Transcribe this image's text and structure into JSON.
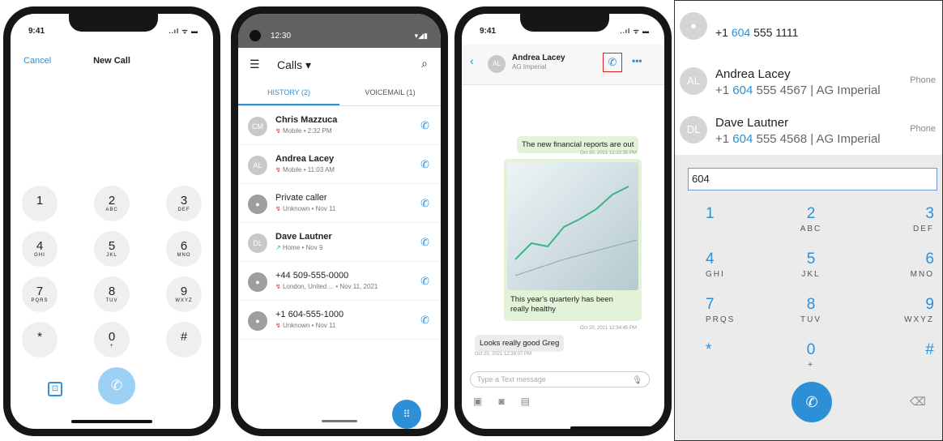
{
  "phone1": {
    "time": "9:41",
    "status_icons": "..ıl ᯤ ▬",
    "cancel": "Cancel",
    "title": "New Call",
    "keys": [
      {
        "d": "1",
        "l": ""
      },
      {
        "d": "2",
        "l": "ABC"
      },
      {
        "d": "3",
        "l": "DEF"
      },
      {
        "d": "4",
        "l": "GHI"
      },
      {
        "d": "5",
        "l": "JKL"
      },
      {
        "d": "6",
        "l": "MNO"
      },
      {
        "d": "7",
        "l": "PQRS"
      },
      {
        "d": "8",
        "l": "TUV"
      },
      {
        "d": "9",
        "l": "WXYZ"
      },
      {
        "d": "*",
        "l": ""
      },
      {
        "d": "0",
        "l": "+"
      },
      {
        "d": "#",
        "l": ""
      }
    ],
    "contacts_icon": "contacts-book-icon",
    "call_icon": "phone-icon"
  },
  "phone2": {
    "time": "12:30",
    "status_icons": "▾◢▮",
    "title": "Calls ▾",
    "tabs": [
      "HISTORY (2)",
      "VOICEMAIL (1)"
    ],
    "rows": [
      {
        "initials": "CM",
        "name": "Chris Mazzuca",
        "dir": "missed",
        "sub": "Mobile • 2:32 PM"
      },
      {
        "initials": "AL",
        "name": "Andrea Lacey",
        "dir": "missed",
        "sub": "Mobile • 11:03 AM"
      },
      {
        "initials": "",
        "name": "Private caller",
        "dir": "missed",
        "sub": "Unknown • Nov 11"
      },
      {
        "initials": "DL",
        "name": "Dave Lautner",
        "dir": "outgoing",
        "sub": "Home • Nov 9"
      },
      {
        "initials": "",
        "name": "+44 509-555-0000",
        "dir": "missed",
        "sub": "London, United ... • Nov 11, 2021"
      },
      {
        "initials": "",
        "name": "+1 604-555-1000",
        "dir": "missed",
        "sub": "Unknown • Nov 11"
      }
    ]
  },
  "phone3": {
    "time": "9:41",
    "status_icons": "..ıl ᯤ ▬",
    "contact_initials": "AL",
    "contact_name": "Andrea Lacey",
    "company": "AG Imperial",
    "messages": {
      "m1": "The new financial reports are out",
      "t1": "Oct 20, 2021 12:22:35 PM",
      "m2": "This year's quarterly has been really healthy",
      "t2": "Oct 20, 2021 12:34:45 PM",
      "m3": "Looks really good Greg",
      "t3": "Oct 20, 2021 12:38:07 PM"
    },
    "input_placeholder": "Type a Text message"
  },
  "panel4": {
    "results": [
      {
        "initials": "",
        "pre": "+1 ",
        "hl": "604",
        "post": " 555 1111",
        "label": ""
      },
      {
        "initials": "AL",
        "name": "Andrea Lacey",
        "pre": "+1 ",
        "hl": "604",
        "post": " 555 4567  | AG Imperial",
        "label": "Phone"
      },
      {
        "initials": "DL",
        "name": "Dave Lautner",
        "pre": "+1 ",
        "hl": "604",
        "post": " 555 4568  | AG Imperial",
        "label": "Phone"
      }
    ],
    "field_value": "604",
    "keys": [
      {
        "d": "1",
        "l": ""
      },
      {
        "d": "2",
        "l": "ABC"
      },
      {
        "d": "3",
        "l": "DEF"
      },
      {
        "d": "4",
        "l": "GHI"
      },
      {
        "d": "5",
        "l": "JKL"
      },
      {
        "d": "6",
        "l": "MNO"
      },
      {
        "d": "7",
        "l": "PRQS"
      },
      {
        "d": "8",
        "l": "TUV"
      },
      {
        "d": "9",
        "l": "WXYZ"
      },
      {
        "d": "*",
        "l": ""
      },
      {
        "d": "0",
        "l": "+"
      },
      {
        "d": "#",
        "l": ""
      }
    ]
  },
  "colors": {
    "accent": "#2d8fd5",
    "missed": "#d33",
    "outgoing": "#2a8",
    "bubble_out": "#e3f3d8",
    "bubble_in": "#ececec"
  }
}
